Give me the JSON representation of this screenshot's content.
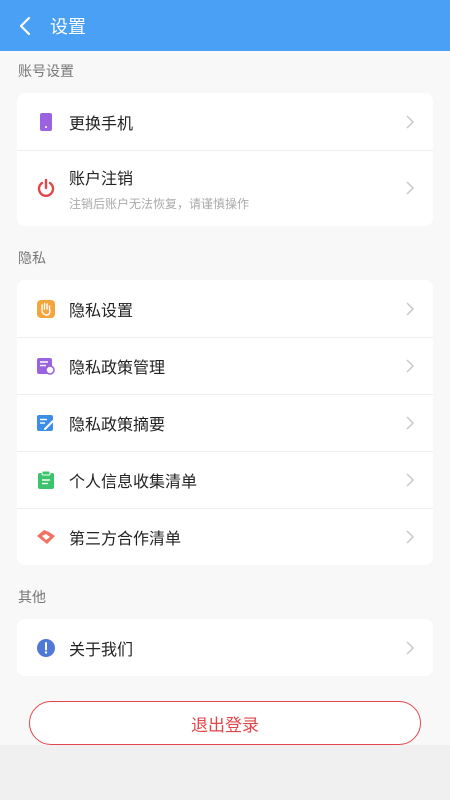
{
  "header": {
    "title": "设置"
  },
  "sections": {
    "account": {
      "title": "账号设置",
      "items": [
        {
          "label": "更换手机"
        },
        {
          "label": "账户注销",
          "sublabel": "注销后账户无法恢复，请谨慎操作"
        }
      ]
    },
    "privacy": {
      "title": "隐私",
      "items": [
        {
          "label": "隐私设置"
        },
        {
          "label": "隐私政策管理"
        },
        {
          "label": "隐私政策摘要"
        },
        {
          "label": "个人信息收集清单"
        },
        {
          "label": "第三方合作清单"
        }
      ]
    },
    "other": {
      "title": "其他",
      "items": [
        {
          "label": "关于我们"
        }
      ]
    }
  },
  "logout_label": "退出登录",
  "colors": {
    "header_bg": "#4aa0f4",
    "logout_red": "#e2464a"
  },
  "icons": [
    "phone-icon",
    "power-icon",
    "hand-icon",
    "policy-manage-icon",
    "policy-summary-icon",
    "clipboard-icon",
    "handshake-icon",
    "info-icon"
  ]
}
